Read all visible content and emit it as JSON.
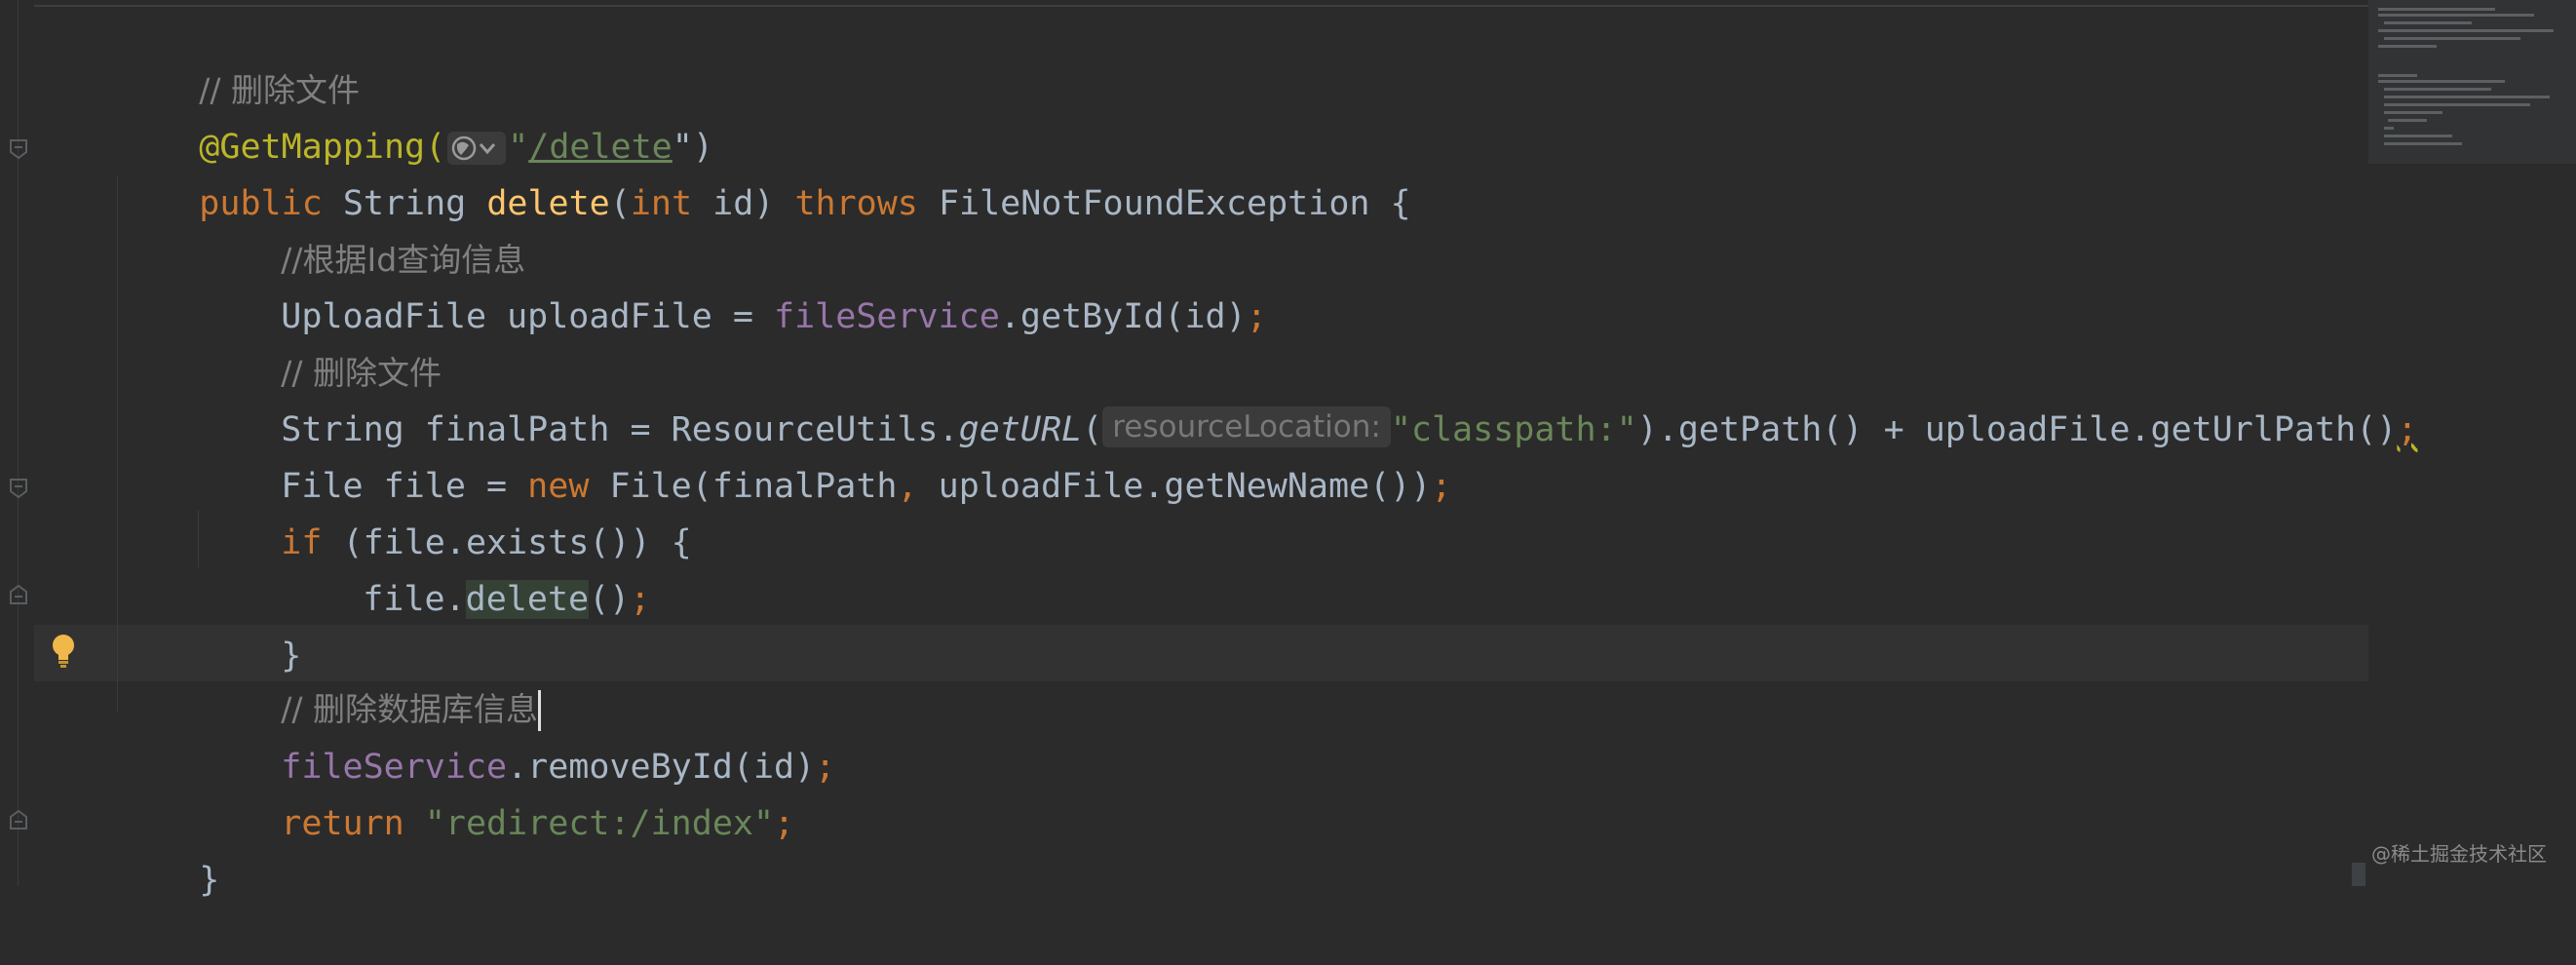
{
  "code": {
    "l1": {
      "comment": "// 删除文件"
    },
    "l2": {
      "annotation": "@GetMapping(",
      "open_quote": "\"",
      "path": "/delete",
      "close": "\")"
    },
    "l3": {
      "public": "public",
      "type": "String",
      "name": "delete",
      "open": "(",
      "int": "int",
      "param": "id) ",
      "throws": "throws",
      "exc": "FileNotFoundException {"
    },
    "l4": {
      "comment": "//根据Id查询信息"
    },
    "l5": {
      "prefix": "UploadFile uploadFile = ",
      "field": "fileService",
      "call": ".getById(id)",
      "semi": ";"
    },
    "l6": {
      "comment": "// 删除文件"
    },
    "l7": {
      "prefix": "String finalPath = ResourceUtils.",
      "method": "getURL",
      "open": "(",
      "hint": "resourceLocation:",
      "str": "\"classpath:\"",
      "rest": ").getPath() + uploadFile.getUrlPath()",
      "semi": ";"
    },
    "l8": {
      "prefix": "File file = ",
      "new": "new",
      "mid": " File(finalPath",
      "comma": ",",
      "rest": " uploadFile.getNewName())",
      "semi": ";"
    },
    "l9": {
      "if": "if",
      "rest": " (file.exists()) {"
    },
    "l10": {
      "prefix": "file.",
      "method": "delete",
      "rest": "()",
      "semi": ";"
    },
    "l11": {
      "text": "}"
    },
    "l12": {
      "comment": "// 删除数据库信息"
    },
    "l13": {
      "field": "fileService",
      "rest": ".removeById(id)",
      "semi": ";"
    },
    "l14": {
      "return": "return",
      "str": "\"redirect:/index\"",
      "semi": ";"
    },
    "l15": {
      "text": "}"
    }
  },
  "icons": {
    "globe": "globe-icon",
    "bulb": "lightbulb-icon",
    "fold": "fold-marker-icon"
  },
  "watermark": "@稀土掘金技术社区",
  "colors": {
    "background": "#2b2b2b",
    "keyword": "#cc7832",
    "annotation": "#bbb529",
    "field": "#9876aa",
    "method": "#ffc66d",
    "string": "#6a8759",
    "comment": "#808080",
    "text": "#a9b7c6"
  }
}
